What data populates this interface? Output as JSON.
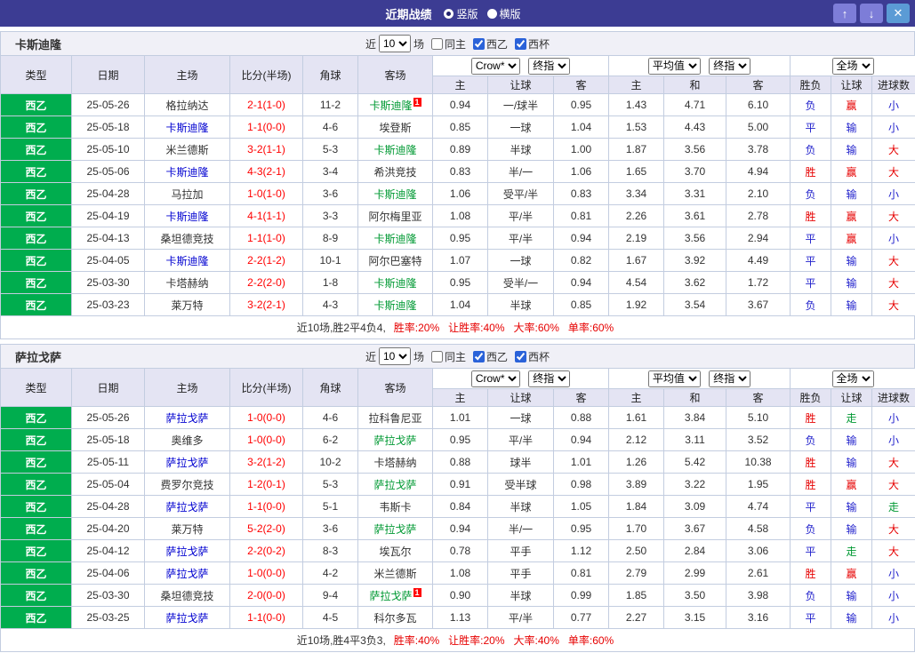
{
  "titlebar": {
    "title": "近期战绩",
    "vertical_label": "竖版",
    "horizontal_label": "横版",
    "up_icon": "↑",
    "down_icon": "↓",
    "close_icon": "✕"
  },
  "filter": {
    "near_label": "近",
    "count_value": "10",
    "games_label": "场",
    "same_home_label": "同主",
    "same_home_checked": false,
    "league_label": "西乙",
    "league_checked": true,
    "cup_label": "西杯",
    "cup_checked": true
  },
  "dropdowns": {
    "company": "Crow*",
    "final": "终指",
    "average": "平均值",
    "full": "全场"
  },
  "columns": [
    "类型",
    "日期",
    "主场",
    "比分(半场)",
    "角球",
    "客场",
    "主",
    "让球",
    "客",
    "主",
    "和",
    "客",
    "胜负",
    "让球",
    "进球数"
  ],
  "value_colors": {
    "胜": "#e60000",
    "平": "#2222cc",
    "负": "#2222cc",
    "赢": "#e60000",
    "输": "#2222cc",
    "走": "#009933",
    "大": "#e60000",
    "小": "#2222cc"
  },
  "sections": [
    {
      "team": "卡斯迪隆",
      "rows": [
        {
          "league": "西乙",
          "date": "25-05-26",
          "home": "格拉纳达",
          "home_ref": false,
          "score": "2-1(1-0)",
          "corner": "11-2",
          "away": "卡斯迪隆",
          "away_ref": true,
          "away_badge": "1",
          "asia": [
            "0.94",
            "一/球半",
            "0.95"
          ],
          "euro": [
            "1.43",
            "4.71",
            "6.10"
          ],
          "result": "负",
          "handicap": "赢",
          "goals": "小"
        },
        {
          "league": "西乙",
          "date": "25-05-18",
          "home": "卡斯迪隆",
          "home_ref": true,
          "score": "1-1(0-0)",
          "corner": "4-6",
          "away": "埃登斯",
          "away_ref": false,
          "asia": [
            "0.85",
            "一球",
            "1.04"
          ],
          "euro": [
            "1.53",
            "4.43",
            "5.00"
          ],
          "result": "平",
          "handicap": "输",
          "goals": "小"
        },
        {
          "league": "西乙",
          "date": "25-05-10",
          "home": "米兰德斯",
          "home_ref": false,
          "score": "3-2(1-1)",
          "corner": "5-3",
          "away": "卡斯迪隆",
          "away_ref": true,
          "asia": [
            "0.89",
            "半球",
            "1.00"
          ],
          "euro": [
            "1.87",
            "3.56",
            "3.78"
          ],
          "result": "负",
          "handicap": "输",
          "goals": "大"
        },
        {
          "league": "西乙",
          "date": "25-05-06",
          "home": "卡斯迪隆",
          "home_ref": true,
          "score": "4-3(2-1)",
          "corner": "3-4",
          "away": "希洪竞技",
          "away_ref": false,
          "asia": [
            "0.83",
            "半/一",
            "1.06"
          ],
          "euro": [
            "1.65",
            "3.70",
            "4.94"
          ],
          "result": "胜",
          "handicap": "赢",
          "goals": "大"
        },
        {
          "league": "西乙",
          "date": "25-04-28",
          "home": "马拉加",
          "home_ref": false,
          "score": "1-0(1-0)",
          "corner": "3-6",
          "away": "卡斯迪隆",
          "away_ref": true,
          "asia": [
            "1.06",
            "受平/半",
            "0.83"
          ],
          "euro": [
            "3.34",
            "3.31",
            "2.10"
          ],
          "result": "负",
          "handicap": "输",
          "goals": "小"
        },
        {
          "league": "西乙",
          "date": "25-04-19",
          "home": "卡斯迪隆",
          "home_ref": true,
          "score": "4-1(1-1)",
          "corner": "3-3",
          "away": "阿尔梅里亚",
          "away_ref": false,
          "asia": [
            "1.08",
            "平/半",
            "0.81"
          ],
          "euro": [
            "2.26",
            "3.61",
            "2.78"
          ],
          "result": "胜",
          "handicap": "赢",
          "goals": "大"
        },
        {
          "league": "西乙",
          "date": "25-04-13",
          "home": "桑坦德竞技",
          "home_ref": false,
          "score": "1-1(1-0)",
          "corner": "8-9",
          "away": "卡斯迪隆",
          "away_ref": true,
          "asia": [
            "0.95",
            "平/半",
            "0.94"
          ],
          "euro": [
            "2.19",
            "3.56",
            "2.94"
          ],
          "result": "平",
          "handicap": "赢",
          "goals": "小"
        },
        {
          "league": "西乙",
          "date": "25-04-05",
          "home": "卡斯迪隆",
          "home_ref": true,
          "score": "2-2(1-2)",
          "corner": "10-1",
          "away": "阿尔巴塞特",
          "away_ref": false,
          "asia": [
            "1.07",
            "一球",
            "0.82"
          ],
          "euro": [
            "1.67",
            "3.92",
            "4.49"
          ],
          "result": "平",
          "handicap": "输",
          "goals": "大"
        },
        {
          "league": "西乙",
          "date": "25-03-30",
          "home": "卡塔赫纳",
          "home_ref": false,
          "score": "2-2(2-0)",
          "corner": "1-8",
          "away": "卡斯迪隆",
          "away_ref": true,
          "asia": [
            "0.95",
            "受半/一",
            "0.94"
          ],
          "euro": [
            "4.54",
            "3.62",
            "1.72"
          ],
          "result": "平",
          "handicap": "输",
          "goals": "大"
        },
        {
          "league": "西乙",
          "date": "25-03-23",
          "home": "莱万特",
          "home_ref": false,
          "score": "3-2(2-1)",
          "corner": "4-3",
          "away": "卡斯迪隆",
          "away_ref": true,
          "asia": [
            "1.04",
            "半球",
            "0.85"
          ],
          "euro": [
            "1.92",
            "3.54",
            "3.67"
          ],
          "result": "负",
          "handicap": "输",
          "goals": "大"
        }
      ],
      "summary": {
        "prefix": "近10场,胜2平4负4,",
        "stats": [
          "胜率:20%",
          "让胜率:40%",
          "大率:60%",
          "单率:60%"
        ]
      }
    },
    {
      "team": "萨拉戈萨",
      "rows": [
        {
          "league": "西乙",
          "date": "25-05-26",
          "home": "萨拉戈萨",
          "home_ref": true,
          "score": "1-0(0-0)",
          "corner": "4-6",
          "away": "拉科鲁尼亚",
          "away_ref": false,
          "asia": [
            "1.01",
            "一球",
            "0.88"
          ],
          "euro": [
            "1.61",
            "3.84",
            "5.10"
          ],
          "result": "胜",
          "handicap": "走",
          "goals": "小"
        },
        {
          "league": "西乙",
          "date": "25-05-18",
          "home": "奥维多",
          "home_ref": false,
          "score": "1-0(0-0)",
          "corner": "6-2",
          "away": "萨拉戈萨",
          "away_ref": true,
          "asia": [
            "0.95",
            "平/半",
            "0.94"
          ],
          "euro": [
            "2.12",
            "3.11",
            "3.52"
          ],
          "result": "负",
          "handicap": "输",
          "goals": "小"
        },
        {
          "league": "西乙",
          "date": "25-05-11",
          "home": "萨拉戈萨",
          "home_ref": true,
          "score": "3-2(1-2)",
          "corner": "10-2",
          "away": "卡塔赫纳",
          "away_ref": false,
          "asia": [
            "0.88",
            "球半",
            "1.01"
          ],
          "euro": [
            "1.26",
            "5.42",
            "10.38"
          ],
          "result": "胜",
          "handicap": "输",
          "goals": "大"
        },
        {
          "league": "西乙",
          "date": "25-05-04",
          "home": "费罗尔竞技",
          "home_ref": false,
          "score": "1-2(0-1)",
          "corner": "5-3",
          "away": "萨拉戈萨",
          "away_ref": true,
          "asia": [
            "0.91",
            "受半球",
            "0.98"
          ],
          "euro": [
            "3.89",
            "3.22",
            "1.95"
          ],
          "result": "胜",
          "handicap": "赢",
          "goals": "大"
        },
        {
          "league": "西乙",
          "date": "25-04-28",
          "home": "萨拉戈萨",
          "home_ref": true,
          "score": "1-1(0-0)",
          "corner": "5-1",
          "away": "韦斯卡",
          "away_ref": false,
          "asia": [
            "0.84",
            "半球",
            "1.05"
          ],
          "euro": [
            "1.84",
            "3.09",
            "4.74"
          ],
          "result": "平",
          "handicap": "输",
          "goals": "走"
        },
        {
          "league": "西乙",
          "date": "25-04-20",
          "home": "莱万特",
          "home_ref": false,
          "score": "5-2(2-0)",
          "corner": "3-6",
          "away": "萨拉戈萨",
          "away_ref": true,
          "asia": [
            "0.94",
            "半/一",
            "0.95"
          ],
          "euro": [
            "1.70",
            "3.67",
            "4.58"
          ],
          "result": "负",
          "handicap": "输",
          "goals": "大"
        },
        {
          "league": "西乙",
          "date": "25-04-12",
          "home": "萨拉戈萨",
          "home_ref": true,
          "score": "2-2(0-2)",
          "corner": "8-3",
          "away": "埃瓦尔",
          "away_ref": false,
          "asia": [
            "0.78",
            "平手",
            "1.12"
          ],
          "euro": [
            "2.50",
            "2.84",
            "3.06"
          ],
          "result": "平",
          "handicap": "走",
          "goals": "大"
        },
        {
          "league": "西乙",
          "date": "25-04-06",
          "home": "萨拉戈萨",
          "home_ref": true,
          "score": "1-0(0-0)",
          "corner": "4-2",
          "away": "米兰德斯",
          "away_ref": false,
          "asia": [
            "1.08",
            "平手",
            "0.81"
          ],
          "euro": [
            "2.79",
            "2.99",
            "2.61"
          ],
          "result": "胜",
          "handicap": "赢",
          "goals": "小"
        },
        {
          "league": "西乙",
          "date": "25-03-30",
          "home": "桑坦德竞技",
          "home_ref": false,
          "score": "2-0(0-0)",
          "corner": "9-4",
          "away": "萨拉戈萨",
          "away_ref": true,
          "away_badge": "1",
          "asia": [
            "0.90",
            "半球",
            "0.99"
          ],
          "euro": [
            "1.85",
            "3.50",
            "3.98"
          ],
          "result": "负",
          "handicap": "输",
          "goals": "小"
        },
        {
          "league": "西乙",
          "date": "25-03-25",
          "home": "萨拉戈萨",
          "home_ref": true,
          "score": "1-1(0-0)",
          "corner": "4-5",
          "away": "科尔多瓦",
          "away_ref": false,
          "asia": [
            "1.13",
            "平/半",
            "0.77"
          ],
          "euro": [
            "2.27",
            "3.15",
            "3.16"
          ],
          "result": "平",
          "handicap": "输",
          "goals": "小"
        }
      ],
      "summary": {
        "prefix": "近10场,胜4平3负3,",
        "stats": [
          "胜率:40%",
          "让胜率:20%",
          "大率:40%",
          "单率:60%"
        ]
      }
    }
  ]
}
